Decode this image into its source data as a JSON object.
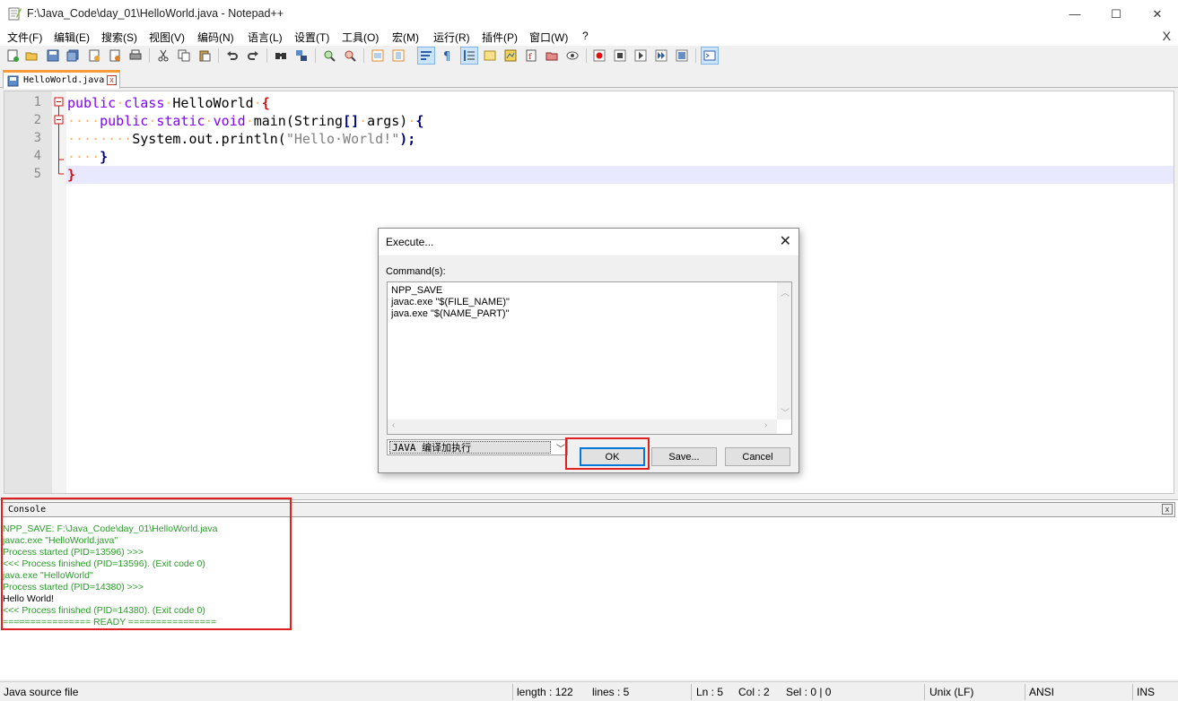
{
  "window": {
    "title": "F:\\Java_Code\\day_01\\HelloWorld.java - Notepad++",
    "minimize": "—",
    "maximize": "☐",
    "close": "✕"
  },
  "menu": {
    "items": [
      "文件(F)",
      "编辑(E)",
      "搜索(S)",
      "视图(V)",
      "编码(N)",
      "语言(L)",
      "设置(T)",
      "工具(O)",
      "宏(M)",
      "运行(R)",
      "插件(P)",
      "窗口(W)",
      "?"
    ],
    "close": "X"
  },
  "tab": {
    "label": "HelloWorld.java",
    "close": "x"
  },
  "editor": {
    "line_numbers": [
      "1",
      "2",
      "3",
      "4",
      "5"
    ],
    "lines": [
      {
        "indent": "",
        "parts": [
          "public",
          "class",
          "HelloWorld",
          "{"
        ]
      },
      {
        "indent": "····",
        "parts": [
          "public",
          "static",
          "void",
          "main(String",
          "[]",
          "args)",
          "{"
        ]
      },
      {
        "indent": "········",
        "parts": [
          "System.out.println(",
          "\"Hello·World!\"",
          ");"
        ]
      },
      {
        "indent": "····",
        "parts": [
          "}"
        ]
      },
      {
        "indent": "",
        "parts": [
          "}"
        ]
      }
    ]
  },
  "console": {
    "title": "Console",
    "close": "x",
    "lines": [
      {
        "text": "NPP_SAVE: F:\\Java_Code\\day_01\\HelloWorld.java",
        "color": "green"
      },
      {
        "text": "javac.exe \"HelloWorld.java\"",
        "color": "green"
      },
      {
        "text": "Process started (PID=13596) >>>",
        "color": "green"
      },
      {
        "text": "<<< Process finished (PID=13596). (Exit code 0)",
        "color": "green"
      },
      {
        "text": "java.exe \"HelloWorld\"",
        "color": "green"
      },
      {
        "text": "Process started (PID=14380) >>>",
        "color": "green"
      },
      {
        "text": "Hello World!",
        "color": "black"
      },
      {
        "text": "<<< Process finished (PID=14380). (Exit code 0)",
        "color": "green"
      },
      {
        "text": "================ READY ================",
        "color": "green"
      }
    ]
  },
  "dialog": {
    "title": "Execute...",
    "close": "✕",
    "commands_label": "Command(s):",
    "commands": "NPP_SAVE\njavac.exe \"$(FILE_NAME)\"\njava.exe \"$(NAME_PART)\"",
    "selected_script": "JAVA 编译加执行",
    "ok": "OK",
    "save": "Save...",
    "cancel": "Cancel"
  },
  "status": {
    "file_type": "Java source file",
    "length": "length : 122",
    "lines": "lines : 5",
    "ln": "Ln : 5",
    "col": "Col : 2",
    "sel": "Sel : 0 | 0",
    "eol": "Unix (LF)",
    "encoding": "ANSI",
    "mode": "INS"
  },
  "colors": {
    "keyword": "#8000ff",
    "operator": "#000080",
    "string": "#808080",
    "console_text": "#2b9a2b",
    "highlight_box": "#e02020",
    "tab_accent": "#fa9b39"
  }
}
